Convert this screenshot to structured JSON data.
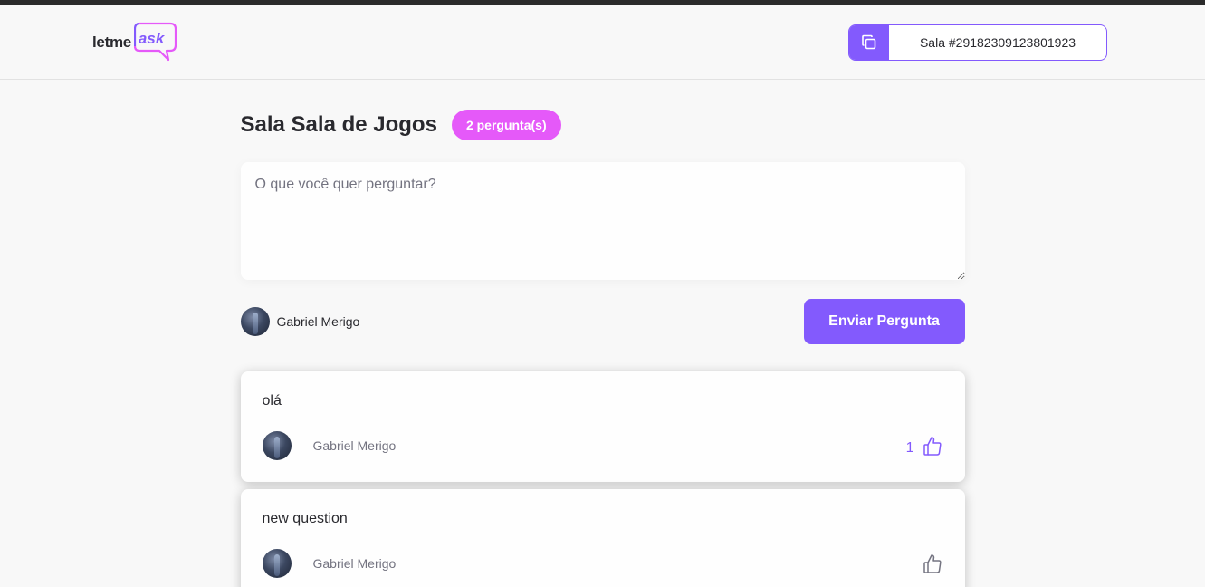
{
  "header": {
    "logo_text": "letme",
    "logo_accent": "ask",
    "room_code_label": "Sala #29182309123801923",
    "copy_icon": "copy-icon"
  },
  "room": {
    "title": "Sala Sala de Jogos",
    "question_count": "2 pergunta(s)"
  },
  "form": {
    "placeholder": "O que você quer perguntar?",
    "user_name": "Gabriel Merigo",
    "submit_label": "Enviar Pergunta"
  },
  "questions": [
    {
      "content": "olá",
      "author": "Gabriel Merigo",
      "like_count": "1",
      "liked": true
    },
    {
      "content": "new question",
      "author": "Gabriel Merigo",
      "like_count": "",
      "liked": false
    }
  ],
  "colors": {
    "accent": "#835afd",
    "badge": "#e559f9",
    "text": "#29292e",
    "muted": "#737380"
  }
}
